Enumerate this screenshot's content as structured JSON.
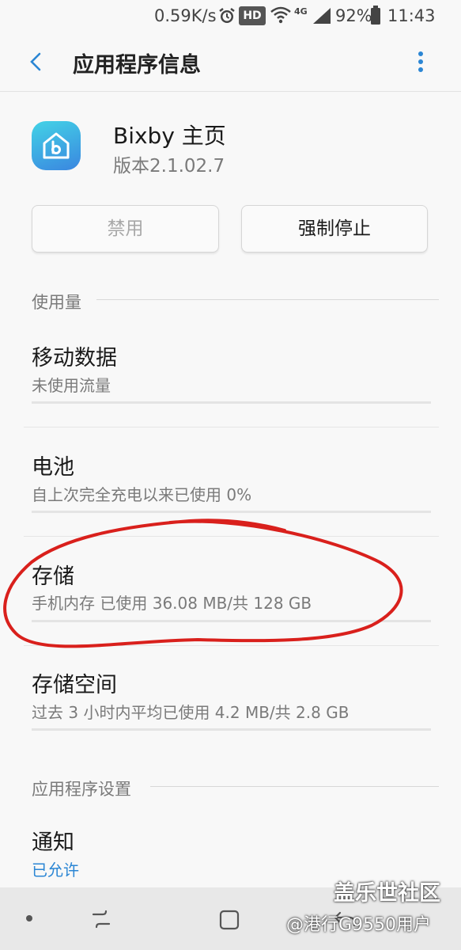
{
  "status_bar": {
    "speed": "0.59K/s",
    "hd": "HD",
    "network": "4G",
    "battery": "92%",
    "time": "11:43",
    "icons": [
      "alarm-icon",
      "wifi-icon",
      "signal-icon",
      "battery-icon"
    ]
  },
  "app_bar": {
    "title": "应用程序信息",
    "back_icon": "chevron-left-icon",
    "more_icon": "more-vertical-icon"
  },
  "app": {
    "name": "Bixby 主页",
    "version": "版本2.1.02.7",
    "icon": "bixby-home-icon"
  },
  "buttons": {
    "disable": "禁用",
    "force_stop": "强制停止"
  },
  "usage_section": {
    "header": "使用量",
    "items": [
      {
        "title": "移动数据",
        "subtitle": "未使用流量"
      },
      {
        "title": "电池",
        "subtitle": "自上次完全充电以来已使用 0%"
      },
      {
        "title": "存储",
        "subtitle": "手机内存 已使用 36.08 MB/共 128 GB"
      },
      {
        "title": "存储空间",
        "subtitle": "过去 3 小时内平均已使用 4.2 MB/共 2.8 GB"
      }
    ]
  },
  "settings_section": {
    "header": "应用程序设置",
    "items": [
      {
        "title": "通知",
        "subtitle": "已允许"
      }
    ]
  },
  "colors": {
    "accent": "#2b86d4",
    "annotation": "#d9201c"
  },
  "nav_bar": {
    "icons": [
      "home-dot-icon",
      "recents-icon",
      "home-icon",
      "back-icon"
    ]
  },
  "watermark": {
    "line1": "盖乐世社区",
    "line2": "@港行G9550用户"
  }
}
